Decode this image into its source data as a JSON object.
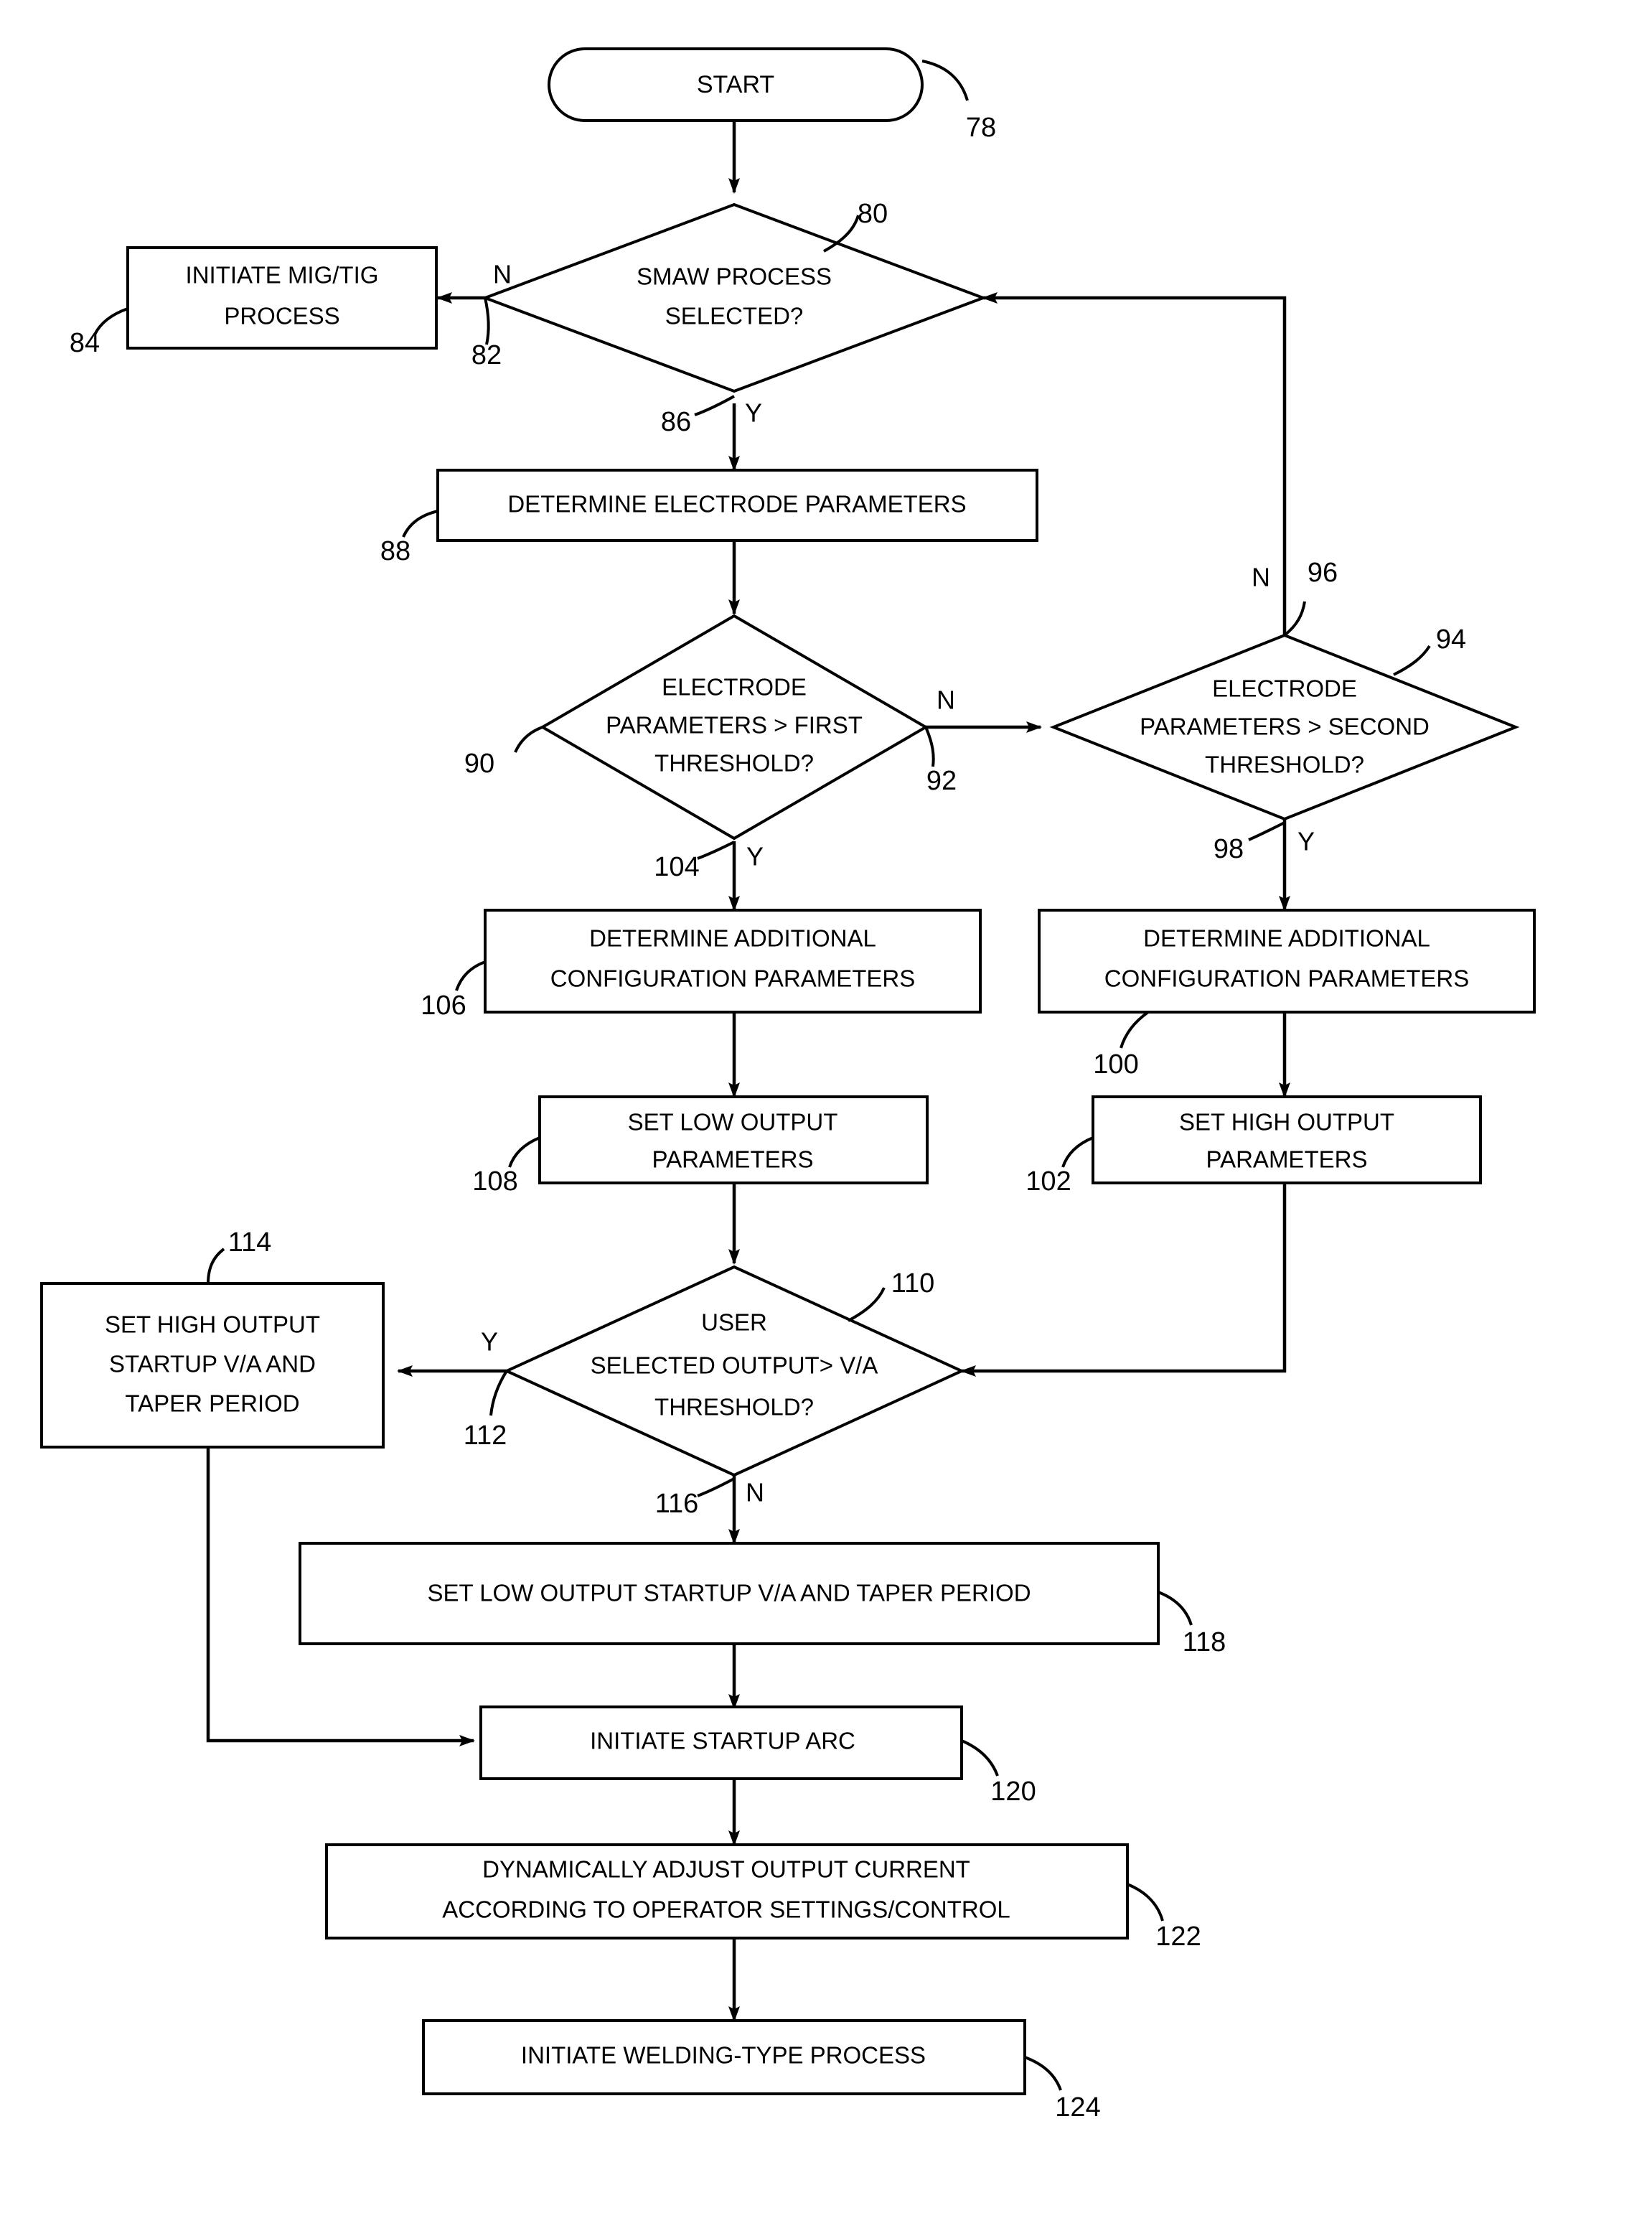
{
  "figure": {
    "type": "flowchart",
    "title": "",
    "nodes": {
      "start": {
        "label": "START",
        "ref": "78",
        "shape": "terminator"
      },
      "smaw_decision": {
        "label_line1": "SMAW PROCESS",
        "label_line2": "SELECTED?",
        "ref": "80",
        "shape": "decision"
      },
      "migtig": {
        "label_line1": "INITIATE MIG/TIG",
        "label_line2": "PROCESS",
        "ref": "84",
        "shape": "process"
      },
      "determine_electrode": {
        "label": "DETERMINE ELECTRODE PARAMETERS",
        "ref": "88",
        "shape": "process"
      },
      "first_threshold": {
        "label_line1": "ELECTRODE",
        "label_line2": "PARAMETERS > FIRST",
        "label_line3": "THRESHOLD?",
        "ref": "90",
        "shape": "decision"
      },
      "second_threshold": {
        "label_line1": "ELECTRODE",
        "label_line2": "PARAMETERS > SECOND",
        "label_line3": "THRESHOLD?",
        "ref": "94",
        "shape": "decision"
      },
      "additional_config_left": {
        "label_line1": "DETERMINE ADDITIONAL",
        "label_line2": "CONFIGURATION PARAMETERS",
        "ref": "106",
        "shape": "process"
      },
      "additional_config_right": {
        "label_line1": "DETERMINE ADDITIONAL",
        "label_line2": "CONFIGURATION PARAMETERS",
        "ref": "100",
        "shape": "process"
      },
      "set_low_output": {
        "label_line1": "SET LOW OUTPUT",
        "label_line2": "PARAMETERS",
        "ref": "108",
        "shape": "process"
      },
      "set_high_output": {
        "label_line1": "SET HIGH OUTPUT",
        "label_line2": "PARAMETERS",
        "ref": "102",
        "shape": "process"
      },
      "user_selected_decision": {
        "label_line1": "USER",
        "label_line2": "SELECTED OUTPUT> V/A",
        "label_line3": "THRESHOLD?",
        "ref": "110",
        "shape": "decision"
      },
      "set_high_startup": {
        "label_line1": "SET HIGH OUTPUT",
        "label_line2": "STARTUP V/A AND",
        "label_line3": "TAPER PERIOD",
        "ref": "114",
        "shape": "process"
      },
      "set_low_startup": {
        "label": "SET LOW OUTPUT STARTUP V/A AND TAPER PERIOD",
        "ref": "118",
        "shape": "process"
      },
      "initiate_startup_arc": {
        "label": "INITIATE STARTUP ARC",
        "ref": "120",
        "shape": "process"
      },
      "dynamically_adjust": {
        "label_line1": "DYNAMICALLY ADJUST OUTPUT CURRENT",
        "label_line2": "ACCORDING TO OPERATOR SETTINGS/CONTROL",
        "ref": "122",
        "shape": "process"
      },
      "initiate_welding": {
        "label": "INITIATE WELDING-TYPE PROCESS",
        "ref": "124",
        "shape": "process"
      }
    },
    "branch_labels": {
      "smaw_no": "N",
      "smaw_no_ref": "82",
      "smaw_yes": "Y",
      "smaw_yes_ref": "86",
      "first_threshold_no": "N",
      "first_threshold_no_ref": "92",
      "first_threshold_yes": "Y",
      "first_threshold_yes_ref": "104",
      "second_threshold_no": "N",
      "second_threshold_no_ref": "96",
      "second_threshold_yes": "Y",
      "second_threshold_yes_ref": "98",
      "user_yes": "Y",
      "user_yes_ref": "112",
      "user_no": "N",
      "user_no_ref": "116"
    },
    "colors": {
      "stroke": "#000000",
      "fill": "#ffffff",
      "background": "#ffffff"
    }
  }
}
